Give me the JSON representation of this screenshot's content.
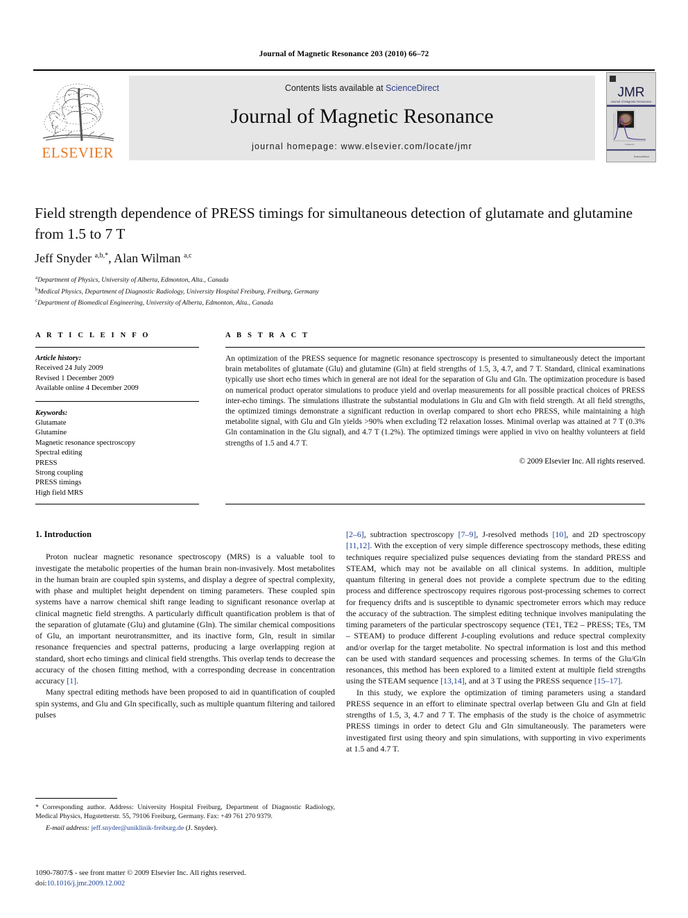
{
  "running_head": "Journal of Magnetic Resonance 203 (2010) 66–72",
  "masthead": {
    "contents_prefix": "Contents lists available at ",
    "sciencedirect": "ScienceDirect",
    "journal_title": "Journal of Magnetic Resonance",
    "homepage": "journal homepage: www.elsevier.com/locate/jmr",
    "publisher_logo_text": "ELSEVIER",
    "cover_title": "JMR",
    "cover_subtitle": "Journal of Magnetic Resonance",
    "cover_footer": "ScienceDirect",
    "link_color": "#2a3b8f",
    "brand_orange": "#E87722"
  },
  "article": {
    "title": "Field strength dependence of PRESS timings for simultaneous detection of glutamate and glutamine from 1.5 to 7 T",
    "authors_html": "Jeff Snyder <sup>a,b,</sup><sup>*</sup>, Alan Wilman <sup>a,c</sup>",
    "affiliations": [
      {
        "marker": "a",
        "text": "Department of Physics, University of Alberta, Edmonton, Alta., Canada"
      },
      {
        "marker": "b",
        "text": "Medical Physics, Department of Diagnostic Radiology, University Hospital Freiburg, Freiburg, Germany"
      },
      {
        "marker": "c",
        "text": "Department of Biomedical Engineering, University of Alberta, Edmonton, Alta., Canada"
      }
    ]
  },
  "article_info": {
    "heading": "A R T I C L E   I N F O",
    "history_label": "Article history:",
    "history": [
      "Received 24 July 2009",
      "Revised 1 December 2009",
      "Available online 4 December 2009"
    ],
    "keywords_label": "Keywords:",
    "keywords": [
      "Glutamate",
      "Glutamine",
      "Magnetic resonance spectroscopy",
      "Spectral editing",
      "PRESS",
      "Strong coupling",
      "PRESS timings",
      "High field MRS"
    ]
  },
  "abstract": {
    "heading": "A B S T R A C T",
    "body": "An optimization of the PRESS sequence for magnetic resonance spectroscopy is presented to simultaneously detect the important brain metabolites of glutamate (Glu) and glutamine (Gln) at field strengths of 1.5, 3, 4.7, and 7 T. Standard, clinical examinations typically use short echo times which in general are not ideal for the separation of Glu and Gln. The optimization procedure is based on numerical product operator simulations to produce yield and overlap measurements for all possible practical choices of PRESS inter-echo timings. The simulations illustrate the substantial modulations in Glu and Gln with field strength. At all field strengths, the optimized timings demonstrate a significant reduction in overlap compared to short echo PRESS, while maintaining a high metabolite signal, with Glu and Gln yields >90% when excluding T2 relaxation losses. Minimal overlap was attained at 7 T (0.3% Gln contamination in the Glu signal), and 4.7 T (1.2%). The optimized timings were applied in vivo on healthy volunteers at field strengths of 1.5 and 4.7 T.",
    "copyright": "© 2009 Elsevier Inc. All rights reserved."
  },
  "body": {
    "section_heading": "1. Introduction",
    "left_paragraphs": [
      "Proton nuclear magnetic resonance spectroscopy (MRS) is a valuable tool to investigate the metabolic properties of the human brain non-invasively. Most metabolites in the human brain are coupled spin systems, and display a degree of spectral complexity, with phase and multiplet height dependent on timing parameters. These coupled spin systems have a narrow chemical shift range leading to significant resonance overlap at clinical magnetic field strengths. A particularly difficult quantification problem is that of the separation of glutamate (Glu) and glutamine (Gln). The similar chemical compositions of Glu, an important neurotransmitter, and its inactive form, Gln, result in similar resonance frequencies and spectral patterns, producing a large overlapping region at standard, short echo timings and clinical field strengths. This overlap tends to decrease the accuracy of the chosen fitting method, with a corresponding decrease in concentration accuracy [1].",
      "Many spectral editing methods have been proposed to aid in quantification of coupled spin systems, and Glu and Gln specifically, such as multiple quantum filtering and tailored pulses"
    ],
    "right_paragraphs": [
      "[2–6], subtraction spectroscopy [7–9], J-resolved methods [10], and 2D spectroscopy [11,12]. With the exception of very simple difference spectroscopy methods, these editing techniques require specialized pulse sequences deviating from the standard PRESS and STEAM, which may not be available on all clinical systems. In addition, multiple quantum filtering in general does not provide a complete spectrum due to the editing process and difference spectroscopy requires rigorous post-processing schemes to correct for frequency drifts and is susceptible to dynamic spectrometer errors which may reduce the accuracy of the subtraction. The simplest editing technique involves manipulating the timing parameters of the particular spectroscopy sequence (TE1, TE2 – PRESS; TEs, TM – STEAM) to produce different J-coupling evolutions and reduce spectral complexity and/or overlap for the target metabolite. No spectral information is lost and this method can be used with standard sequences and processing schemes. In terms of the Glu/Gln resonances, this method has been explored to a limited extent at multiple field strengths using the STEAM sequence [13,14], and at 3 T using the PRESS sequence [15–17].",
      "In this study, we explore the optimization of timing parameters using a standard PRESS sequence in an effort to eliminate spectral overlap between Glu and Gln at field strengths of 1.5, 3, 4.7 and 7 T. The emphasis of the study is the choice of asymmetric PRESS timings in order to detect Glu and Gln simultaneously. The parameters were investigated first using theory and spin simulations, with supporting in vivo experiments at 1.5 and 4.7 T."
    ]
  },
  "footnotes": {
    "corresponding": "* Corresponding author. Address: University Hospital Freiburg, Department of Diagnostic Radiology, Medical Physics, Hugstetterstr. 55, 79106 Freiburg, Germany. Fax: +49 761 270 9379.",
    "email_label": "E-mail address:",
    "email": "jeff.snyder@uniklinik-freiburg.de",
    "email_suffix": "(J. Snyder).",
    "issn_line": "1090-7807/$ - see front matter © 2009 Elsevier Inc. All rights reserved.",
    "doi_label": "doi:",
    "doi": "10.1016/j.jmr.2009.12.002"
  }
}
